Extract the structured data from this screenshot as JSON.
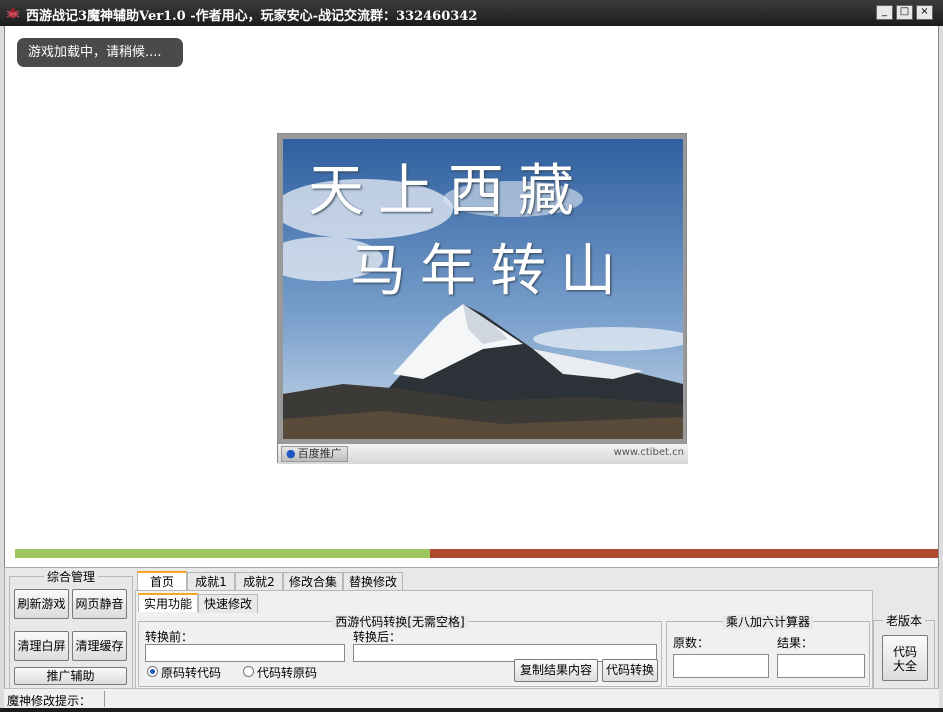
{
  "window": {
    "title": "西游战记3魔神辅助Ver1.0 -作者用心，玩家安心-战记交流群：332460342",
    "minimize_label": "_",
    "maximize_label": "□",
    "close_label": "×"
  },
  "browser": {
    "loading_text": "游戏加载中，请稍候....",
    "progress_fraction": 0.45,
    "ad": {
      "headline_line1": "天上西藏",
      "headline_line2": "马年转山",
      "badge_label": "百度推广",
      "url_text": "www.ctibet.cn"
    }
  },
  "management": {
    "title": "综合管理",
    "refresh_game": "刷新游戏",
    "mute_page": "网页静音",
    "clear_white": "清理白屏",
    "clear_cache": "清理缓存",
    "promote_helper": "推广辅助"
  },
  "tabs": [
    "首页",
    "成就1",
    "成就2",
    "修改合集",
    "替换修改"
  ],
  "subtabs": [
    "实用功能",
    "快速修改"
  ],
  "converter": {
    "title": "西游代码转换[无需空格]",
    "before_label": "转换前：",
    "after_label": "转换后：",
    "before_value": "",
    "after_value": "",
    "radio_orig_to_code": "原码转代码",
    "radio_code_to_orig": "代码转原码",
    "copy_result_button": "复制结果内容",
    "convert_button": "代码转换"
  },
  "calculator": {
    "title": "乘八加六计算器",
    "original_label": "原数：",
    "result_label": "结果：",
    "original_value": "",
    "result_value": ""
  },
  "old_version": {
    "title": "老版本",
    "button_line1": "代码",
    "button_line2": "大全"
  },
  "status": {
    "hint_label": "魔神修改提示："
  },
  "colors": {
    "progress_done": "#9ec761",
    "progress_remaining": "#b04a2e",
    "active_tab_accent": "#f5a623",
    "titlebar": "#1c1c1c"
  }
}
